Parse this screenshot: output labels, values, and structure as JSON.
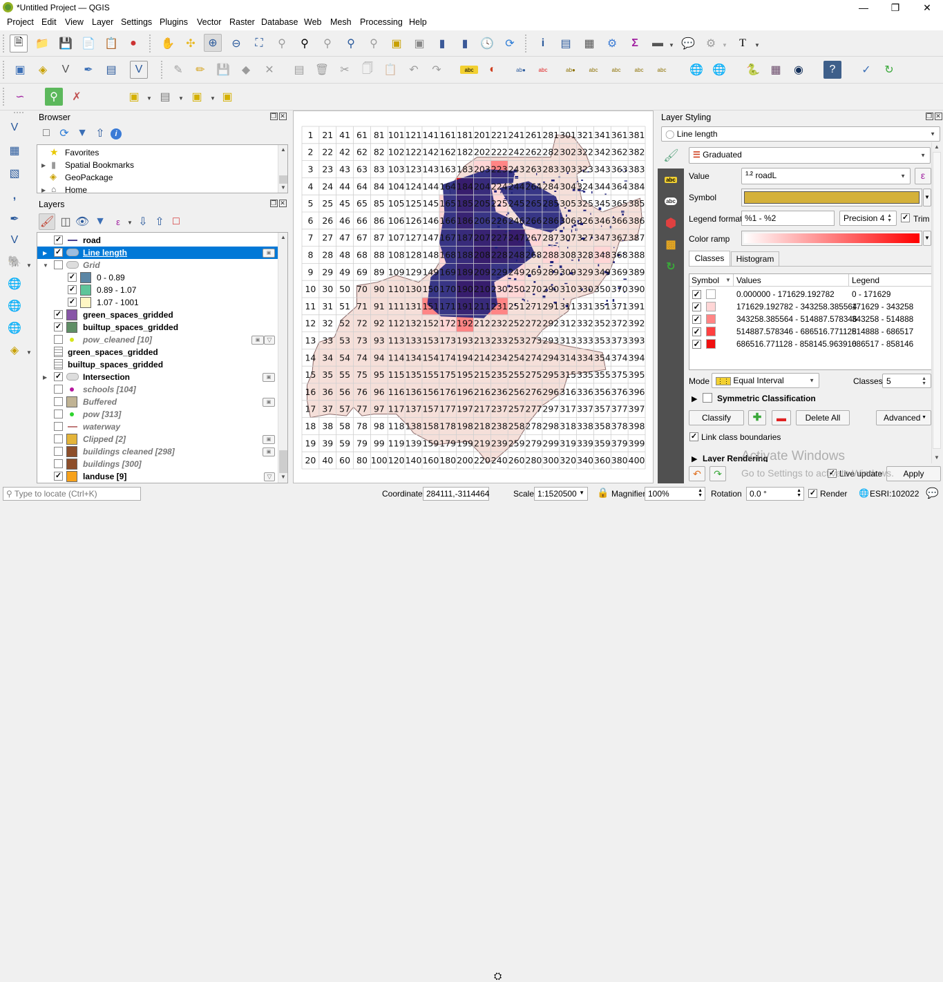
{
  "window": {
    "title": "*Untitled Project — QGIS",
    "controls": [
      "minimize",
      "restore",
      "close"
    ]
  },
  "menubar": [
    "Project",
    "Edit",
    "View",
    "Layer",
    "Settings",
    "Plugins",
    "Vector",
    "Raster",
    "Database",
    "Web",
    "Mesh",
    "Processing",
    "Help"
  ],
  "toolbar_icons": {
    "row1": [
      "new-project-icon",
      "open-project-icon",
      "save-project-icon",
      "new-print-layout-icon",
      "layout-manager-icon",
      "style-manager-icon",
      "pan-icon",
      "pan-to-selection-icon",
      "zoom-in-icon",
      "zoom-out-icon",
      "zoom-full-icon",
      "zoom-to-selection-icon",
      "zoom-to-layer-icon",
      "zoom-native-icon",
      "zoom-last-icon",
      "zoom-next-icon",
      "new-map-view-icon",
      "new-3d-map-view-icon",
      "new-bookmark-icon",
      "show-bookmarks-icon",
      "temporal-controller-icon",
      "refresh-icon",
      "identify-icon",
      "attribute-table-icon",
      "field-calculator-icon",
      "toolbox-icon",
      "statistics-icon",
      "measure-icon",
      "map-tips-icon",
      "actions-icon",
      "text-annotation-icon"
    ],
    "row2": [
      "data-source-manager-icon",
      "new-geopackage-icon",
      "new-shapefile-icon",
      "new-temp-scratch-icon",
      "new-virtual-layer-icon",
      "digitize-icon",
      "current-edits-icon",
      "toggle-editing-icon",
      "save-edits-icon",
      "add-polygon-icon",
      "vertex-tool-icon",
      "modify-attributes-icon",
      "delete-selected-icon",
      "cut-icon",
      "copy-icon",
      "paste-icon",
      "undo-icon",
      "redo-icon",
      "label-toolbar-icon",
      "diagram-icon",
      "layer-labeling-icon",
      "rule-labeling-icon",
      "pin-labels-icon",
      "show-hide-labels-icon",
      "move-label-icon",
      "rotate-label-icon",
      "change-label-icon",
      "wms-icon",
      "wcs-icon",
      "python-console-icon",
      "raster-calculator-icon",
      "globe-icon",
      "help-icon",
      "georeferencer-icon",
      "refresh-table-icon"
    ],
    "row3": [
      "profile-tool-icon",
      "locator-search-icon",
      "map-swipe-icon",
      "select-features-icon",
      "select-by-value-icon",
      "deselect-icon",
      "select-by-location-icon"
    ]
  },
  "left_toolbar": [
    "add-vector-icon",
    "add-raster-icon",
    "add-mesh-icon",
    "add-delimited-text-icon",
    "add-spatialite-icon",
    "add-virtual-layer-icon",
    "add-postgis-icon",
    "add-wms-icon",
    "add-xyz-icon",
    "add-wfs-icon",
    "add-geopackage-icon"
  ],
  "browser": {
    "title": "Browser",
    "items": [
      {
        "label": "Favorites",
        "icon": "star-icon",
        "expandable": false
      },
      {
        "label": "Spatial Bookmarks",
        "icon": "bookmark-icon",
        "expandable": true
      },
      {
        "label": "GeoPackage",
        "icon": "geopackage-icon",
        "expandable": false
      },
      {
        "label": "Home",
        "icon": "home-icon",
        "expandable": true
      }
    ]
  },
  "layers": {
    "title": "Layers",
    "items": [
      {
        "label": "road",
        "checked": true,
        "symbol": "line",
        "color": "#4a3f8c",
        "style": "bold"
      },
      {
        "label": "Line length",
        "checked": true,
        "symbol": "polygon-group",
        "style": "selected",
        "expander": "collapsed",
        "indicator": "embedded"
      },
      {
        "label": "Grid",
        "checked": false,
        "symbol": "polygon-group",
        "style": "italic",
        "expander": "expanded"
      },
      {
        "label": "0 - 0.89",
        "checked": true,
        "color": "#5b86a5",
        "child": true
      },
      {
        "label": "0.89 - 1.07",
        "checked": true,
        "color": "#5ec59a",
        "child": true
      },
      {
        "label": "1.07 - 1001",
        "checked": true,
        "color": "#fff6c4",
        "child": true
      },
      {
        "label": "green_spaces_gridded",
        "checked": true,
        "color": "#8856a7",
        "style": "bold"
      },
      {
        "label": "builtup_spaces_gridded",
        "checked": true,
        "color": "#5f8e65",
        "style": "bold"
      },
      {
        "label": "pow_cleaned [10]",
        "checked": false,
        "symbol": "point",
        "color": "#d6e51c",
        "style": "italic",
        "indicator": "embedded-filter"
      },
      {
        "label": "green_spaces_gridded",
        "checked": null,
        "symbol": "table",
        "style": "bold"
      },
      {
        "label": "builtup_spaces_gridded",
        "checked": null,
        "symbol": "table",
        "style": "bold"
      },
      {
        "label": "Intersection",
        "checked": true,
        "symbol": "polygon-group",
        "style": "bold",
        "expander": "collapsed",
        "indicator": "embedded"
      },
      {
        "label": "schools [104]",
        "checked": false,
        "symbol": "point",
        "color": "#b5179e",
        "style": "italic"
      },
      {
        "label": "Buffered",
        "checked": false,
        "color": "#c0b394",
        "style": "italic",
        "indicator": "embedded"
      },
      {
        "label": "pow [313]",
        "checked": false,
        "symbol": "point",
        "color": "#2ed42e",
        "style": "italic"
      },
      {
        "label": "waterway",
        "checked": false,
        "symbol": "line",
        "color": "#c07a7a",
        "style": "italic"
      },
      {
        "label": "Clipped [2]",
        "checked": false,
        "color": "#e4b43a",
        "style": "italic",
        "indicator": "embedded"
      },
      {
        "label": "buildings cleaned [298]",
        "checked": false,
        "color": "#8d4e2a",
        "style": "italic",
        "indicator": "embedded"
      },
      {
        "label": "buildings [300]",
        "checked": false,
        "color": "#8d4e2a",
        "style": "italic"
      },
      {
        "label": "landuse [9]",
        "checked": true,
        "color": "#f7a21b",
        "style": "bold",
        "indicator": "filter"
      }
    ]
  },
  "map": {
    "grid_rows": 20,
    "grid_cols": 20,
    "first_cell_label": 1,
    "cell_numbering": "column-major"
  },
  "styling": {
    "title": "Layer Styling",
    "layer": "Line length",
    "renderer": "Graduated",
    "value_label": "Value",
    "value_field": "roadL",
    "value_type_badge": "1.2",
    "symbol_label": "Symbol",
    "symbol_color": "#d4b13a",
    "legend_format_label": "Legend format",
    "legend_format": "%1 - %2",
    "precision": "Precision 4",
    "trim_label": "Trim",
    "trim_checked": true,
    "color_ramp_label": "Color ramp",
    "color_ramp": [
      "#ffffff",
      "#ff0000"
    ],
    "tabs": [
      "Classes",
      "Histogram"
    ],
    "active_tab": "Classes",
    "class_headers": [
      "Symbol",
      "Values",
      "Legend"
    ],
    "classes": [
      {
        "checked": true,
        "color": "#ffffff",
        "values": "0.000000 - 171629.192782",
        "legend": "0 - 171629"
      },
      {
        "checked": true,
        "color": "#ffd6d6",
        "values": "171629.192782 - 343258.385564",
        "legend": "171629 - 343258"
      },
      {
        "checked": true,
        "color": "#ff8585",
        "values": "343258.385564 - 514887.578346",
        "legend": "343258 - 514888"
      },
      {
        "checked": true,
        "color": "#ff4040",
        "values": "514887.578346 - 686516.771128",
        "legend": "514888 - 686517"
      },
      {
        "checked": true,
        "color": "#f01010",
        "values": "686516.771128 - 858145.963910",
        "legend": "686517 - 858146"
      }
    ],
    "mode_label": "Mode",
    "mode": "Equal Interval",
    "classes_label": "Classes",
    "classes_count": "5",
    "symmetric_label": "Symmetric Classification",
    "symmetric_checked": false,
    "classify_btn": "Classify",
    "delete_all_btn": "Delete All",
    "advanced_btn": "Advanced",
    "link_boundaries_label": "Link class boundaries",
    "link_boundaries_checked": true,
    "layer_rendering_label": "Layer Rendering",
    "live_update_label": "Live update",
    "live_update_checked": true,
    "apply_btn": "Apply"
  },
  "watermark": {
    "line1": "Activate Windows",
    "line2": "Go to Settings to activate Windows."
  },
  "statusbar": {
    "locator_placeholder": "Type to locate (Ctrl+K)",
    "coordinate_label": "Coordinate",
    "coordinate": "284111,-3114464",
    "scale_label": "Scale",
    "scale": "1:1520500",
    "magnifier_label": "Magnifier",
    "magnifier": "100%",
    "rotation_label": "Rotation",
    "rotation": "0.0 °",
    "render_label": "Render",
    "render_checked": true,
    "crs": "ESRI:102022"
  }
}
